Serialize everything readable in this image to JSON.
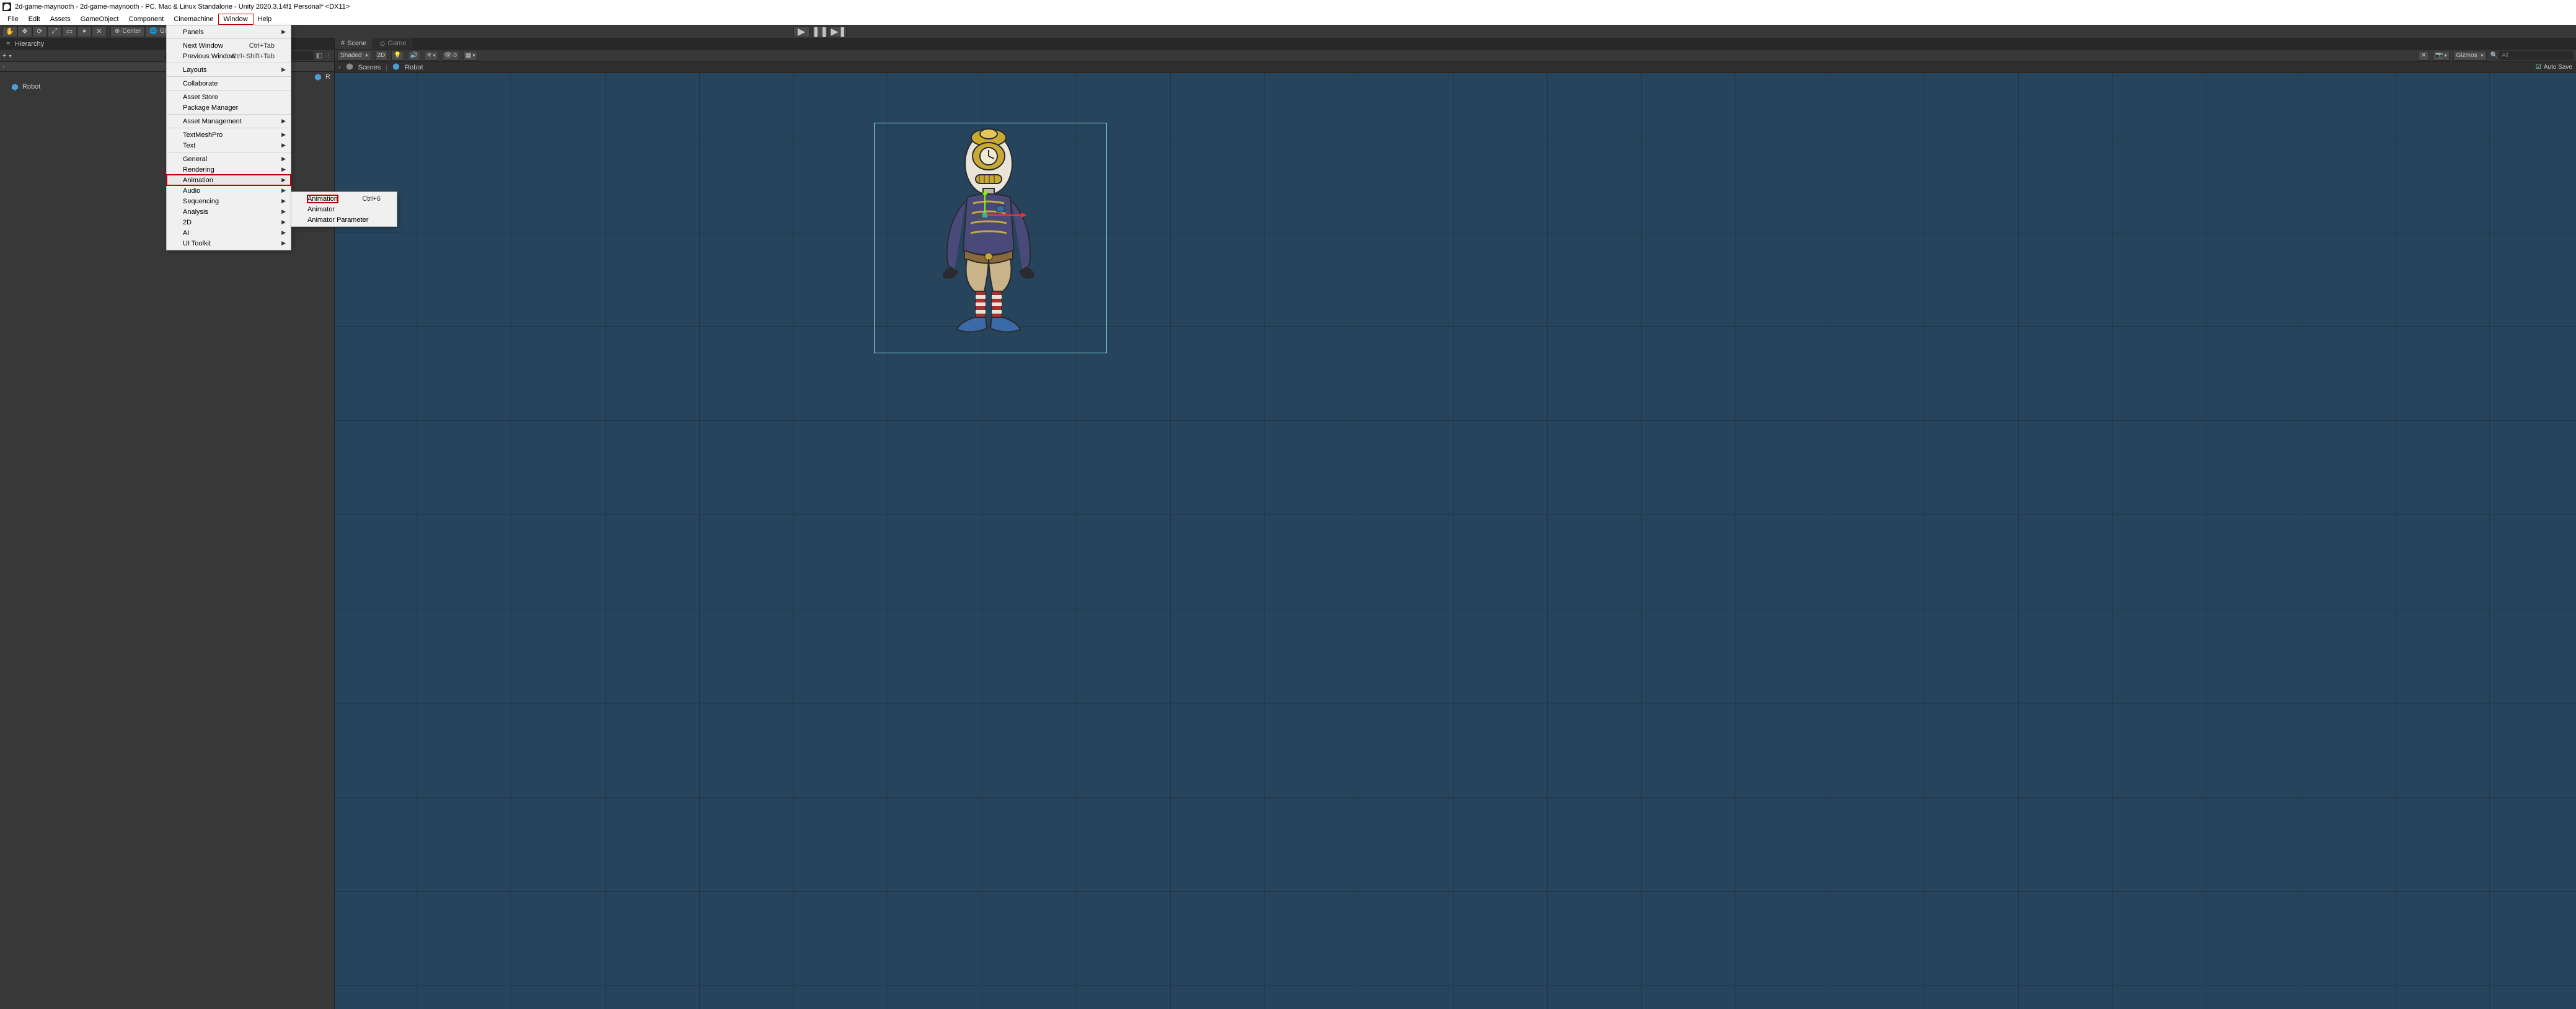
{
  "titlebar": {
    "text": "2d-game-maynooth - 2d-game-maynooth - PC, Mac & Linux Standalone - Unity 2020.3.14f1 Personal* <DX11>"
  },
  "menubar": {
    "items": [
      "File",
      "Edit",
      "Assets",
      "GameObject",
      "Component",
      "Cinemachine",
      "Window",
      "Help"
    ],
    "open_index": 6
  },
  "toolbar": {
    "center_label": "Center",
    "global_label": "Global"
  },
  "hierarchy": {
    "tab": "Hierarchy",
    "add": "+",
    "search_placeholder": "",
    "scene_icon_letter": "",
    "item": "Robot",
    "scene_cut_label": "R"
  },
  "scene": {
    "tabs": {
      "scene": "Scene",
      "game": "Game"
    },
    "shading": "Shaded",
    "mode2d": "2D",
    "fx_count": "0",
    "gizmos": "Gizmos",
    "search_placeholder": "All",
    "breadcrumb_scenes": "Scenes",
    "breadcrumb_item": "Robot",
    "autosave": "Auto Save"
  },
  "window_menu": {
    "items": [
      {
        "label": "Panels",
        "submenu": true
      },
      {
        "sep": true
      },
      {
        "label": "Next Window",
        "shortcut": "Ctrl+Tab"
      },
      {
        "label": "Previous Window",
        "shortcut": "Ctrl+Shift+Tab"
      },
      {
        "sep": true
      },
      {
        "label": "Layouts",
        "submenu": true
      },
      {
        "sep": true
      },
      {
        "label": "Collaborate"
      },
      {
        "sep": true
      },
      {
        "label": "Asset Store"
      },
      {
        "label": "Package Manager"
      },
      {
        "sep": true
      },
      {
        "label": "Asset Management",
        "submenu": true
      },
      {
        "sep": true
      },
      {
        "label": "TextMeshPro",
        "submenu": true
      },
      {
        "label": "Text",
        "submenu": true
      },
      {
        "sep": true
      },
      {
        "label": "General",
        "submenu": true
      },
      {
        "label": "Rendering",
        "submenu": true
      },
      {
        "label": "Animation",
        "submenu": true,
        "boxed": true,
        "hl": true
      },
      {
        "label": "Audio",
        "submenu": true
      },
      {
        "label": "Sequencing",
        "submenu": true
      },
      {
        "label": "Analysis",
        "submenu": true
      },
      {
        "label": "2D",
        "submenu": true
      },
      {
        "label": "AI",
        "submenu": true
      },
      {
        "label": "UI Toolkit",
        "submenu": true
      }
    ]
  },
  "animation_submenu": {
    "items": [
      {
        "label": "Animation",
        "shortcut": "Ctrl+6",
        "boxed": true
      },
      {
        "label": "Animator"
      },
      {
        "label": "Animator Parameter"
      }
    ]
  }
}
